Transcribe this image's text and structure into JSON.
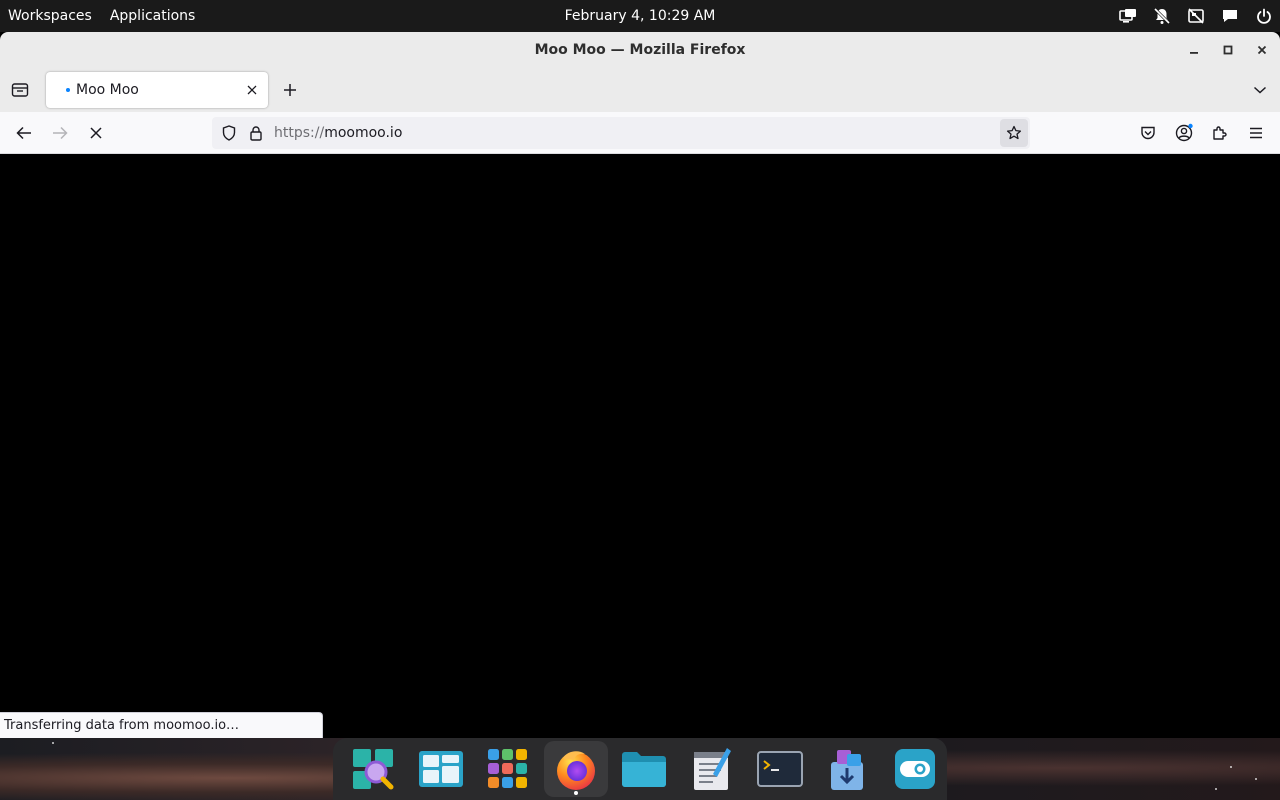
{
  "topbar": {
    "workspaces_label": "Workspaces",
    "applications_label": "Applications",
    "clock": "February 4, 10:29 AM",
    "tray_icons": [
      "display-icon",
      "notifications-muted-icon",
      "camera-off-icon",
      "chat-icon",
      "power-icon"
    ]
  },
  "window": {
    "title": "Moo Moo — Mozilla Firefox"
  },
  "tabs": [
    {
      "label": "Moo Moo",
      "loading": true
    }
  ],
  "navbar": {
    "url_scheme": "https://",
    "url_host": "moomoo.io"
  },
  "status": {
    "text": "Transferring data from moomoo.io…"
  },
  "dock": {
    "apps": [
      {
        "name": "Search",
        "icon": "search-app-icon"
      },
      {
        "name": "Workspaces overview",
        "icon": "workspaces-app-icon"
      },
      {
        "name": "App grid",
        "icon": "app-grid-icon"
      },
      {
        "name": "Firefox",
        "icon": "firefox-icon",
        "running": true
      },
      {
        "name": "Files",
        "icon": "folder-icon"
      },
      {
        "name": "Text Editor",
        "icon": "text-editor-icon"
      },
      {
        "name": "Terminal",
        "icon": "terminal-icon"
      },
      {
        "name": "Software",
        "icon": "software-store-icon"
      },
      {
        "name": "Settings",
        "icon": "toggle-settings-icon"
      }
    ]
  },
  "colors": {
    "topbar_bg": "#1a1a1a",
    "titlebar_bg": "#ebebeb",
    "accent": "#0a84ff",
    "page_bg": "#000000"
  }
}
